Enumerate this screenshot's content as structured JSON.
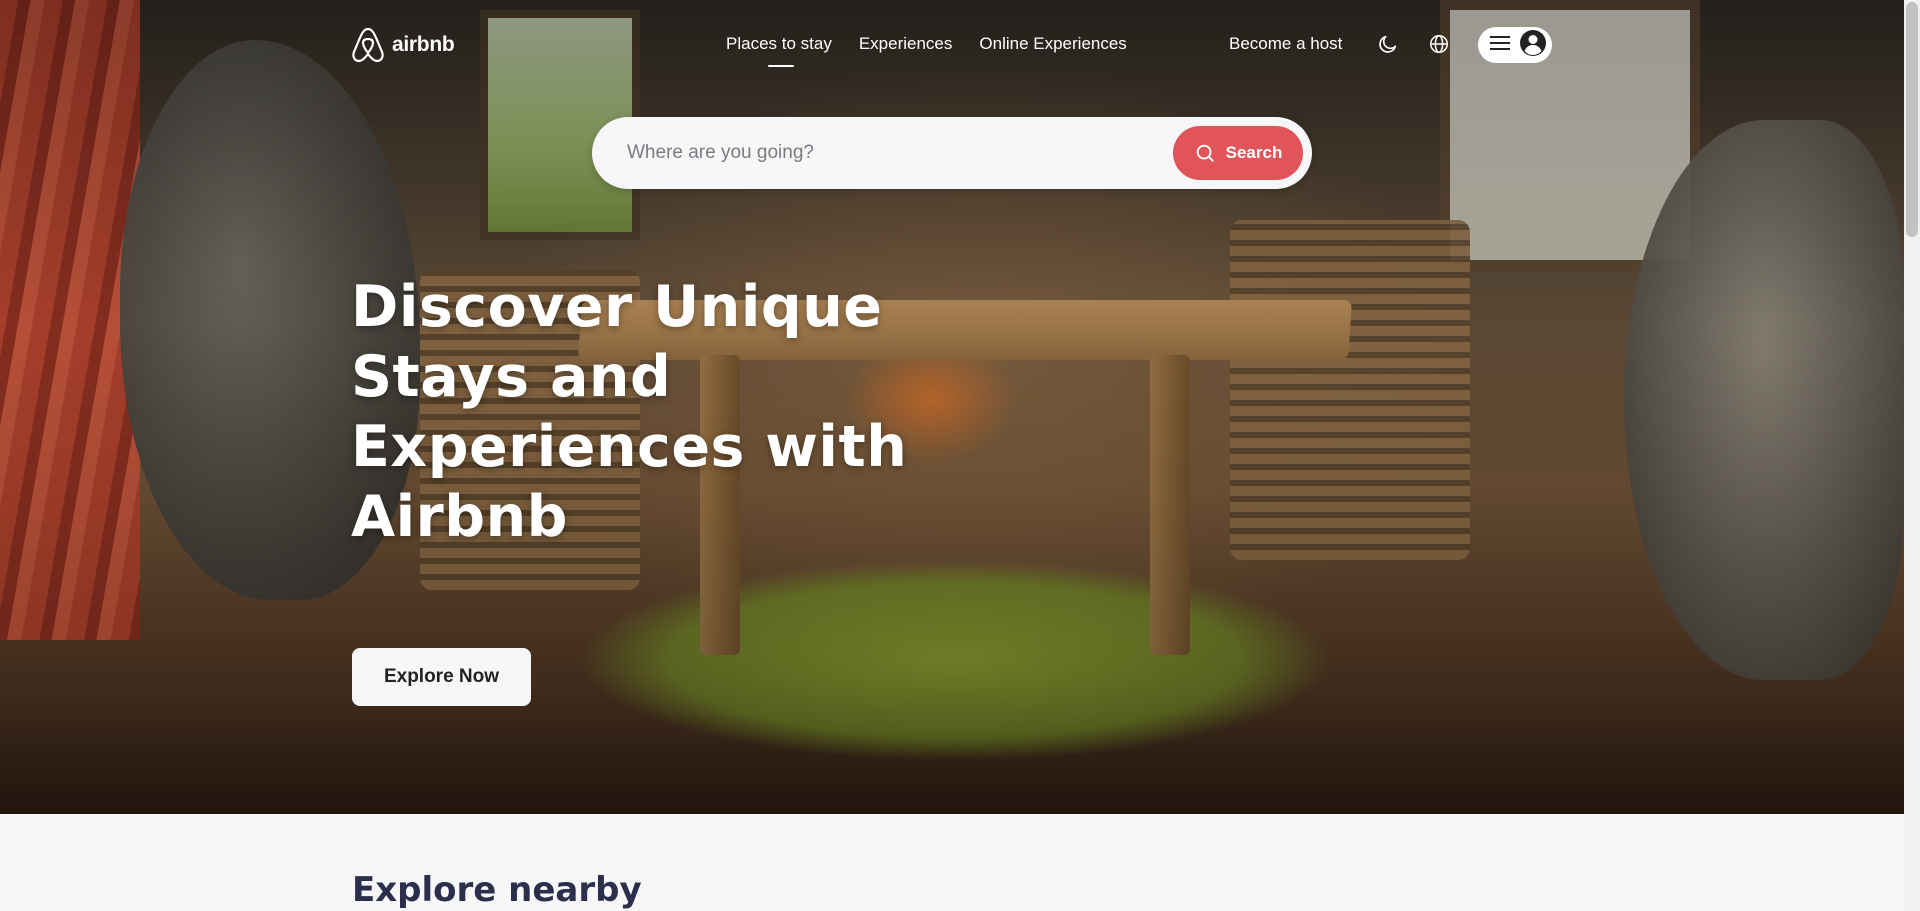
{
  "brand": {
    "name": "airbnb",
    "accent": "#e1555a"
  },
  "nav": {
    "items": [
      {
        "label": "Places to stay",
        "active": true
      },
      {
        "label": "Experiences"
      },
      {
        "label": "Online Experiences"
      }
    ],
    "host_link": "Become a host",
    "icons": [
      "moon-icon",
      "globe-icon",
      "menu-icon",
      "user-icon"
    ]
  },
  "search": {
    "placeholder": "Where are you going?",
    "value": "",
    "button_label": "Search"
  },
  "hero": {
    "headline": "Discover Unique Stays and Experiences with Airbnb",
    "cta_label": "Explore Now"
  },
  "section": {
    "title": "Explore nearby"
  }
}
